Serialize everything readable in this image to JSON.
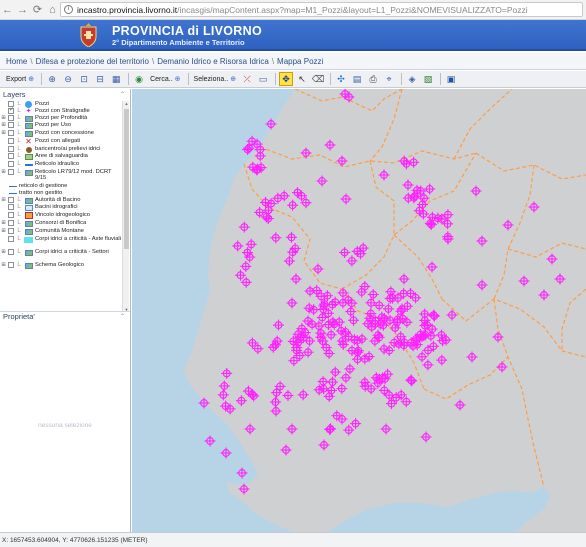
{
  "browser": {
    "url_host": "incastro.provincia.livorno.it",
    "url_path": "/incasgis/mapContent.aspx?map=M1_Pozzi&layout=L1_Pozzi&NOMEVISUALIZZATO=Pozzi"
  },
  "header": {
    "title": "PROVINCIA di LIVORNO",
    "subtitle": "2° Dipartimento Ambiente e Territorio"
  },
  "breadcrumb": [
    "Home",
    "Difesa e protezione del territorio",
    "Demanio Idrico e Risorsa Idrica",
    "Mappa Pozzi"
  ],
  "toolbar": {
    "export_label": "Export",
    "search_label": "Cerca..",
    "select_label": "Seleziona..",
    "active_tool": "identify-tool-icon"
  },
  "sidebar": {
    "layers_title": "Layers",
    "properties_title": "Proprieta'",
    "no_selection": "nessuna selezione",
    "layers": [
      {
        "label": "Pozzi",
        "expander": false,
        "checked": false,
        "icon": "blue-dot-icon"
      },
      {
        "label": "Pozzi con Stratigrafie",
        "expander": false,
        "checked": true,
        "icon": "magenta-star-icon"
      },
      {
        "label": "Pozzi per Profondità",
        "expander": true,
        "checked": false,
        "icon": "layer-group-icon"
      },
      {
        "label": "Pozzi per Uso",
        "expander": true,
        "checked": false,
        "icon": "layer-group-icon"
      },
      {
        "label": "Pozzi con concessione",
        "expander": true,
        "checked": false,
        "icon": "layer-group-icon"
      },
      {
        "label": "Pozzi con allegati",
        "expander": false,
        "checked": false,
        "icon": "red-x-icon"
      },
      {
        "label": "baricentro/ai prelievi idrici",
        "expander": false,
        "checked": false,
        "icon": "brown-dot-icon"
      },
      {
        "label": "Aree di salvaguardia",
        "expander": false,
        "checked": false,
        "icon": "green-area-icon"
      },
      {
        "label": "Reticolo idraulico",
        "expander": false,
        "checked": false,
        "icon": "blue-line-icon"
      },
      {
        "label": "Reticolo LR79/12 mod. DCRT 9/15",
        "expander": true,
        "checked": false,
        "icon": "layer-group-icon"
      },
      {
        "label": "reticolo di gestione",
        "expander": false,
        "checked": false,
        "icon": "legend-line-icon",
        "indent": true
      },
      {
        "label": "tratto non gestito",
        "expander": false,
        "checked": false,
        "icon": "legend-line-icon",
        "indent": true
      },
      {
        "label": "Autorità di Bacino",
        "expander": true,
        "checked": false,
        "icon": "layer-group-icon"
      },
      {
        "label": "Bacini idrografici",
        "expander": false,
        "checked": false,
        "icon": "basin-icon"
      },
      {
        "label": "Vincolo idrogeologico",
        "expander": false,
        "checked": false,
        "icon": "red-square-icon"
      },
      {
        "label": "Consorzi di Bonifica",
        "expander": true,
        "checked": false,
        "icon": "layer-group-icon"
      },
      {
        "label": "Comunità Montane",
        "expander": true,
        "checked": false,
        "icon": "layer-group-icon"
      },
      {
        "label": "Corpi idrici a criticità - Aste fluviali",
        "expander": false,
        "checked": false,
        "icon": "cyan-rect-icon"
      },
      {
        "label": "Corpi idrici a criticità - Settori",
        "expander": true,
        "checked": false,
        "icon": "layer-group-icon"
      },
      {
        "label": "Schema Geologico",
        "expander": true,
        "checked": false,
        "icon": "layer-group-icon"
      }
    ]
  },
  "map": {
    "well_color": "#ff22ff",
    "sea_color": "#b7d4e6",
    "land_color": "#cfd0d2",
    "boundary_color": "#ff9a3c"
  },
  "status": {
    "coordinates": "X: 1657453.604904, Y: 4770626.151235 (METER)"
  }
}
